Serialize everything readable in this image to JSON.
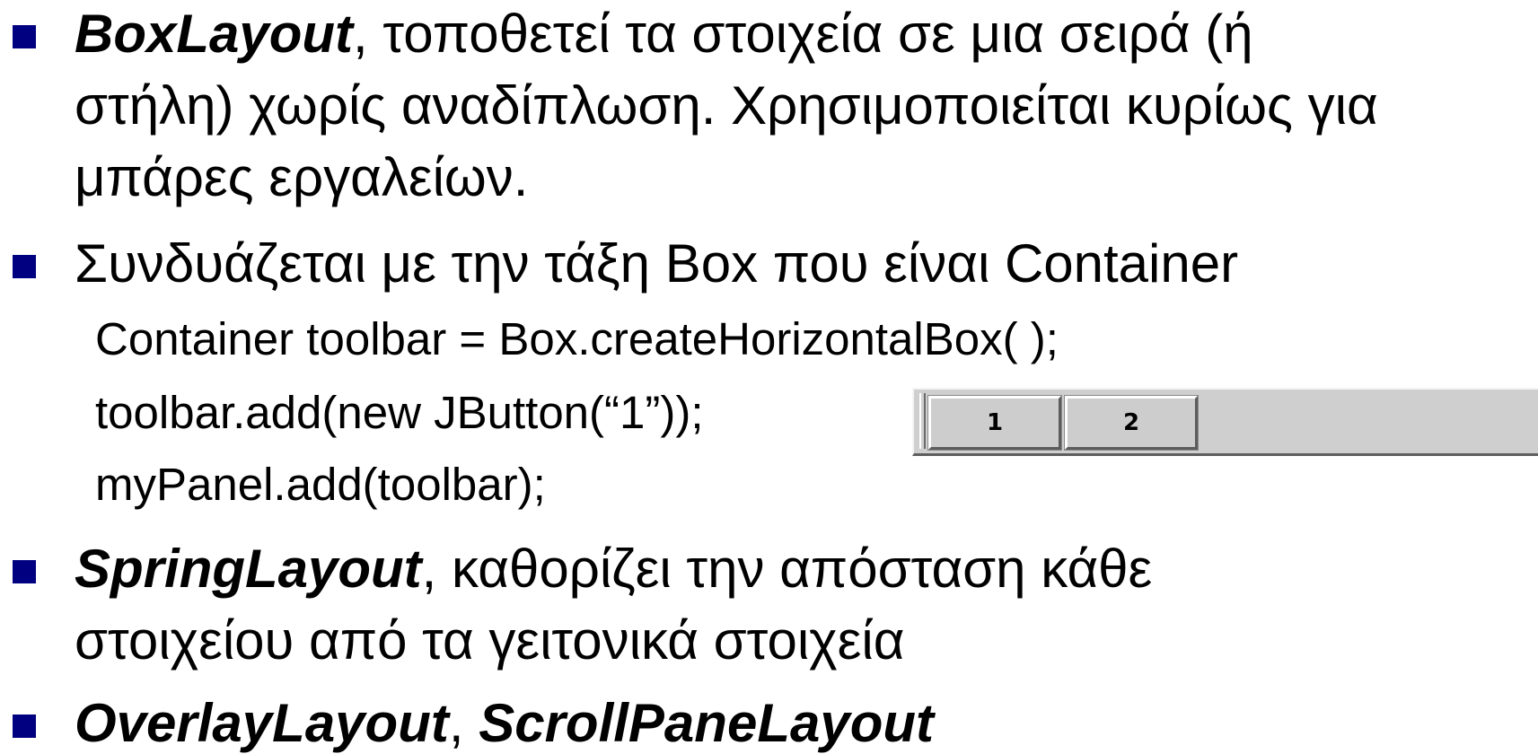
{
  "bullets": [
    {
      "term": "BoxLayout",
      "line1_rest": ", τοποθετεί τα στοιχεία σε μια σειρά (ή",
      "line2": "στήλη) χωρίς αναδίπλωση. Χρησιμοποιείται κυρίως για",
      "line3": "μπάρες εργαλείων."
    },
    {
      "text": "Συνδυάζεται με την τάξη Box που είναι Container",
      "code": [
        "Container toolbar = Box.createHorizontalBox( );",
        "toolbar.add(new JButton(“1”));",
        "myPanel.add(toolbar);"
      ]
    },
    {
      "term": "SpringLayout",
      "line1_rest": ", καθορίζει την απόσταση κάθε",
      "line2": "στοιχείου από τα γειτονικά στοιχεία"
    },
    {
      "term1": "OverlayLayout",
      "separator": ", ",
      "term2": "ScrollPaneLayout"
    }
  ],
  "toolbar_demo": {
    "buttons": [
      "1",
      "2"
    ]
  },
  "colors": {
    "bullet": "#000080",
    "text": "#000000",
    "toolbar_bg": "#cfcfcf"
  }
}
